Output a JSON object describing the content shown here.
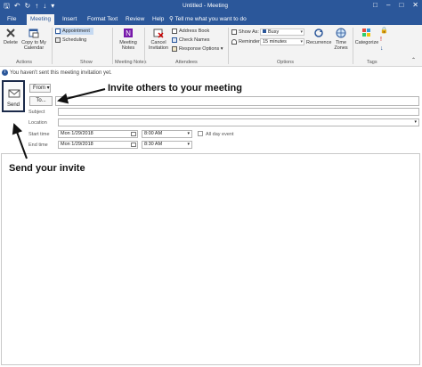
{
  "titlebar": {
    "title": "Untitled - Meeting",
    "qat": [
      "save-icon",
      "undo-icon",
      "redo-icon",
      "up-arrow-icon",
      "down-arrow-icon",
      "customize-icon"
    ]
  },
  "tabs": [
    {
      "label": "File"
    },
    {
      "label": "Meeting"
    },
    {
      "label": "Insert"
    },
    {
      "label": "Format Text"
    },
    {
      "label": "Review"
    },
    {
      "label": "Help"
    }
  ],
  "tell_me": "Tell me what you want to do",
  "ribbon": {
    "actions": {
      "label": "Actions",
      "delete": "Delete",
      "copy_calendar": "Copy to My Calendar"
    },
    "show": {
      "label": "Show",
      "appointment": "Appointment",
      "scheduling": "Scheduling"
    },
    "meeting_notes": {
      "label": "Meeting Notes",
      "button": "Meeting Notes"
    },
    "attendees": {
      "label": "Attendees",
      "cancel_invitation": "Cancel Invitation",
      "address_book": "Address Book",
      "check_names": "Check Names",
      "response_options": "Response Options"
    },
    "options": {
      "label": "Options",
      "show_as_label": "Show As:",
      "show_as_value": "Busy",
      "reminder_label": "Reminder:",
      "reminder_value": "15 minutes",
      "recurrence": "Recurrence",
      "time_zones": "Time Zones"
    },
    "tags": {
      "label": "Tags",
      "categorize": "Categorize"
    }
  },
  "info_bar": "You haven't sent this meeting invitation yet.",
  "form": {
    "send": "Send",
    "from": "From",
    "to": "To...",
    "subject_label": "Subject",
    "location_label": "Location",
    "start_time_label": "Start time",
    "end_time_label": "End time",
    "start_date": "Mon 1/29/2018",
    "start_time": "8:00 AM",
    "end_date": "Mon 1/29/2018",
    "end_time": "8:30 AM",
    "all_day": "All day event",
    "all_day_checked": false
  },
  "callouts": {
    "invite": "Invite others to your meeting",
    "send": "Send your invite"
  },
  "colors": {
    "brand": "#2b579a",
    "ribbon_bg": "#f3f3f3"
  }
}
